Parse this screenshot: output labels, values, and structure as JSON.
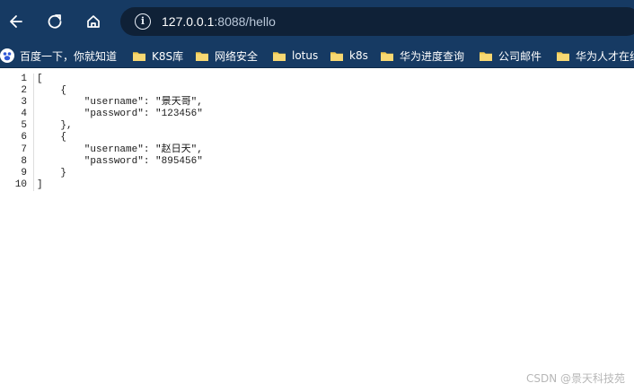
{
  "browser": {
    "url_host": "127.0.0.1",
    "url_path": ":8088/hello",
    "nav": [
      "back",
      "reload",
      "home"
    ]
  },
  "bookmarks": [
    {
      "label": "百度一下，你就知道",
      "icon": "baidu-icon"
    },
    {
      "label": "K8S库",
      "icon": "folder-icon"
    },
    {
      "label": "网络安全",
      "icon": "folder-icon"
    },
    {
      "label": "lotus",
      "icon": "folder-icon"
    },
    {
      "label": "k8s",
      "icon": "folder-icon"
    },
    {
      "label": "华为进度查询",
      "icon": "folder-icon"
    },
    {
      "label": "公司邮件",
      "icon": "folder-icon"
    },
    {
      "label": "华为人才在线",
      "icon": "folder-icon"
    }
  ],
  "code_lines": [
    "[",
    "    {",
    "        \"username\": \"景天哥\",",
    "        \"password\": \"123456\"",
    "    },",
    "    {",
    "        \"username\": \"赵日天\",",
    "        \"password\": \"895456\"",
    "    }",
    "]"
  ],
  "watermark": "CSDN @景天科技苑",
  "colors": {
    "toolbar": "#163a63",
    "omnibox": "#0f2137",
    "string": "#a31515"
  }
}
